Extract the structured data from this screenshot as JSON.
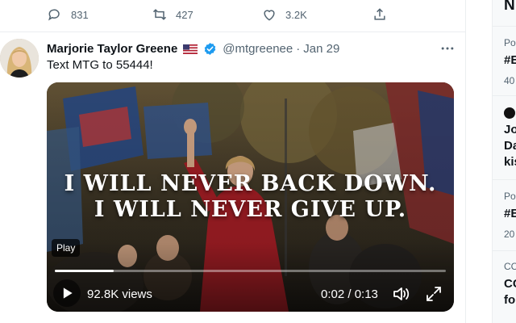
{
  "previous_tweet": {
    "actions": {
      "reply_count": "831",
      "retweet_count": "427",
      "like_count": "3.2K"
    }
  },
  "tweet": {
    "author_name": "Marjorie Taylor Greene",
    "handle": "@mtgreenee",
    "separator": "·",
    "date": "Jan 29",
    "text": "Text MTG to 55444!",
    "video": {
      "caption_line1": "I WILL NEVER BACK DOWN.",
      "caption_line2": "I WILL NEVER GIVE UP.",
      "play_tooltip": "Play",
      "views": "92.8K views",
      "time": "0:02 / 0:13",
      "progress_fraction": 0.15
    }
  },
  "sidebar": {
    "title": "N",
    "items": [
      {
        "context": "Po",
        "title": "#E",
        "count": "40"
      },
      {
        "title_line1": "Jo",
        "title_line2": "Da",
        "title_line3": "kis"
      },
      {
        "context": "Po",
        "title": "#E",
        "count": "20"
      },
      {
        "context": "CC",
        "title_line1": "CC",
        "title_line2": "fo"
      }
    ]
  },
  "colors": {
    "accent": "#1d9bf0",
    "secondary_text": "#536471",
    "border": "#ebeef0",
    "verified": "#1d9bf0"
  },
  "icons": [
    "reply-icon",
    "retweet-icon",
    "like-icon",
    "share-icon",
    "flag-us-icon",
    "verified-badge-icon",
    "more-icon",
    "play-icon",
    "volume-icon",
    "fullscreen-icon"
  ]
}
